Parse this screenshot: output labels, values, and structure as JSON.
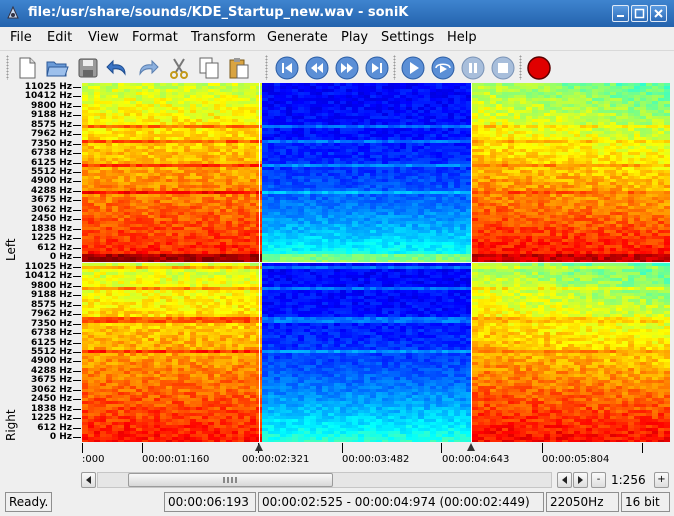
{
  "window": {
    "title": "file:/usr/share/sounds/KDE_Startup_new.wav - soniK"
  },
  "menu": [
    "File",
    "Edit",
    "View",
    "Format",
    "Transform",
    "Generate",
    "Play",
    "Settings",
    "Help"
  ],
  "toolbar": {
    "icons": [
      "new-file-icon",
      "open-folder-icon",
      "save-icon",
      "undo-icon",
      "redo-icon",
      "cut-icon",
      "copy-icon",
      "paste-icon",
      "skip-to-start-icon",
      "rewind-icon",
      "fast-forward-icon",
      "skip-to-end-icon",
      "play-icon",
      "play-loop-icon",
      "pause-icon",
      "stop-icon",
      "record-icon"
    ]
  },
  "channels": {
    "left": "Left",
    "right": "Right"
  },
  "freq_ticks": [
    "11025 Hz",
    "10412 Hz",
    "9800 Hz",
    "9188 Hz",
    "8575 Hz",
    "7962 Hz",
    "7350 Hz",
    "6738 Hz",
    "6125 Hz",
    "5512 Hz",
    "4900 Hz",
    "4288 Hz",
    "3675 Hz",
    "3062 Hz",
    "2450 Hz",
    "1838 Hz",
    "1225 Hz",
    "612 Hz",
    "0 Hz"
  ],
  "timeline": {
    "labels": [
      ":000",
      "00:00:01:160",
      "00:00:02:321",
      "00:00:03:482",
      "00:00:04:643",
      "00:00:05:804"
    ]
  },
  "zoom": {
    "ratio": "1:256",
    "minus": "-",
    "plus": "+"
  },
  "status": {
    "message": "Ready.",
    "length": "00:00:06:193",
    "selection": "00:00:02:525 - 00:00:04:974 (00:00:02:449)",
    "rate": "22050Hz",
    "bits": "16 bit"
  },
  "colors": {
    "titlebar": "#2f73c0",
    "record": "#e00000",
    "selection_bg": "#2a1fb0"
  }
}
